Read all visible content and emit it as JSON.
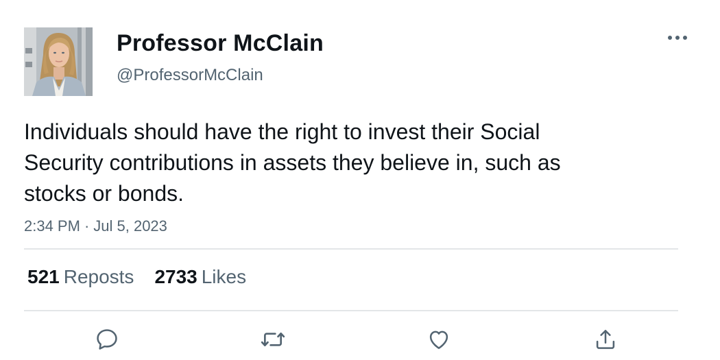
{
  "author": {
    "display_name": "Professor McClain",
    "handle": "@ProfessorMcClain"
  },
  "tweet": {
    "text": "Individuals should have the right to invest their Social Security contributions in assets they believe in, such as stocks or bonds.",
    "time": "2:34 PM",
    "separator": "·",
    "date": "Jul 5, 2023"
  },
  "stats": {
    "reposts_count": "521",
    "reposts_label": "Reposts",
    "likes_count": "2733",
    "likes_label": "Likes"
  },
  "icons": {
    "more": "more-horizontal-icon",
    "reply": "reply-bubble-icon",
    "repost": "repost-arrows-icon",
    "like": "heart-icon",
    "share": "share-upload-icon"
  },
  "colors": {
    "text_primary": "#0f1419",
    "text_secondary": "#536471",
    "divider": "#e3e6e8",
    "icon": "#536471"
  }
}
